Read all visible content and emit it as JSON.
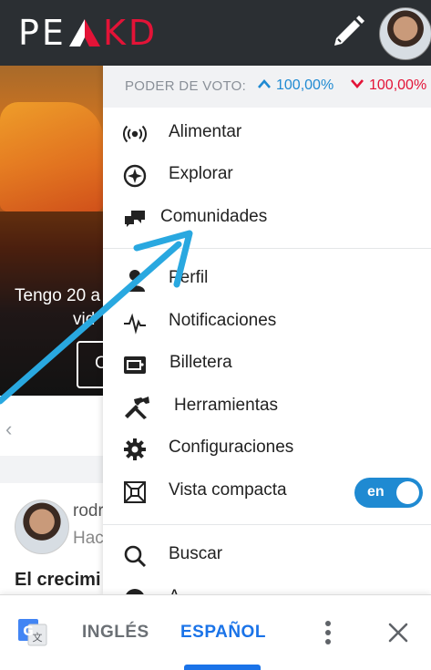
{
  "header": {
    "logo_left": "PE",
    "logo_right": "KD"
  },
  "feed": {
    "overlay_line1": "Tengo 20 a",
    "overlay_line2": "vid",
    "overlay_button": "C",
    "post_author": "rodr",
    "post_subtitle": "Hac",
    "post_title": "El crecimi"
  },
  "vote_power": {
    "label": "PODER DE VOTO:",
    "upvote": "100,00%",
    "downvote": "100,00%",
    "up_color": "#1f8ad2",
    "down_color": "#e31337"
  },
  "menu": {
    "items": [
      {
        "label": "Alimentar",
        "icon": "broadcast-icon"
      },
      {
        "label": "Explorar",
        "icon": "compass-icon"
      },
      {
        "label": "Comunidades",
        "icon": "chat-bubbles-icon"
      },
      {
        "label": "Perfil",
        "icon": "user-icon"
      },
      {
        "label": "Notificaciones",
        "icon": "pulse-icon"
      },
      {
        "label": "Billetera",
        "icon": "wallet-icon"
      },
      {
        "label": "Herramientas",
        "icon": "tools-icon"
      },
      {
        "label": "Configuraciones",
        "icon": "gear-icon"
      },
      {
        "label": "Vista compacta",
        "icon": "compress-icon"
      },
      {
        "label": "Buscar",
        "icon": "search-icon"
      },
      {
        "label": "A",
        "icon": "info-icon"
      }
    ],
    "compact_toggle": "en"
  },
  "translate_bar": {
    "lang_source": "INGLÉS",
    "lang_target": "ESPAÑOL",
    "active_color": "#1a73e8"
  },
  "colors": {
    "brand_red": "#e31337",
    "header_bg": "#2b2f33",
    "arrow": "#29a8e0"
  }
}
